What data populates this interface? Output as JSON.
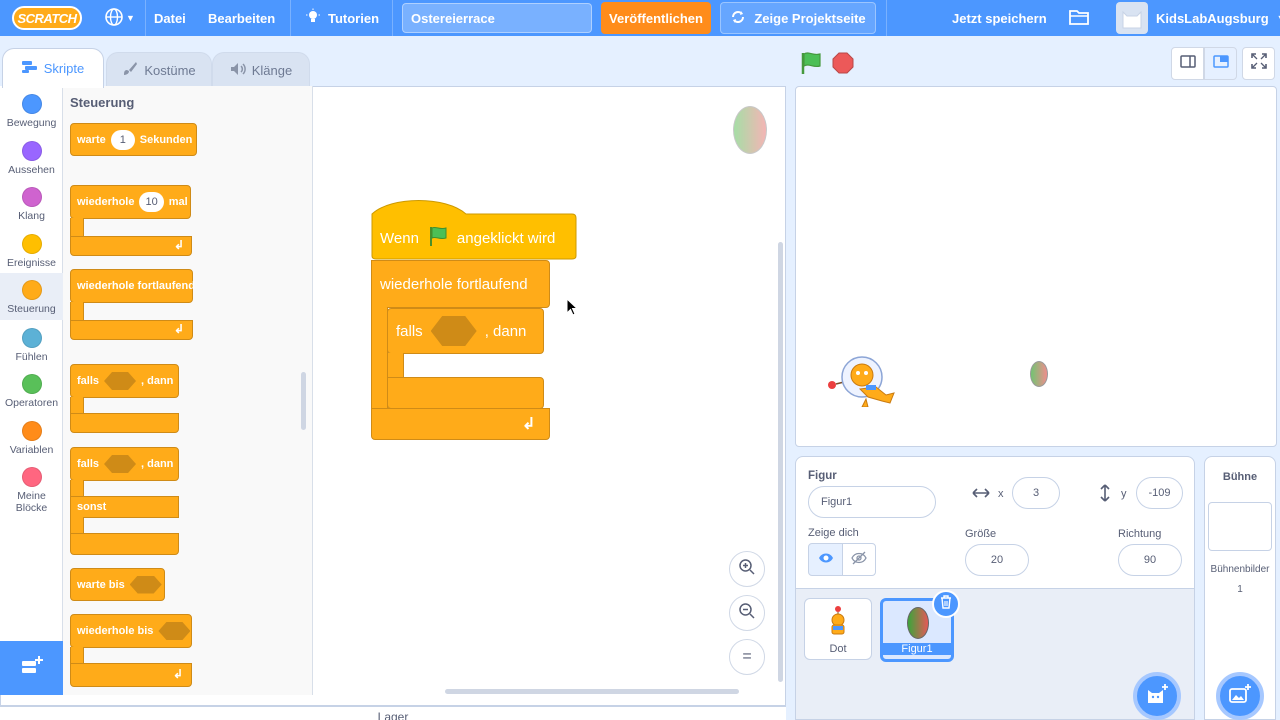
{
  "menubar": {
    "logo": "SCRATCH",
    "file": "Datei",
    "edit": "Bearbeiten",
    "tutorials": "Tutorien",
    "project_title": "Ostereierrace",
    "share": "Veröffentlichen",
    "see_project_page": "Zeige Projektseite",
    "save_now": "Jetzt speichern",
    "username": "KidsLabAugsburg"
  },
  "tabs": {
    "code": "Skripte",
    "costumes": "Kostüme",
    "sounds": "Klänge"
  },
  "categories": [
    {
      "label": "Bewegung",
      "color": "#4c97ff"
    },
    {
      "label": "Aussehen",
      "color": "#9966ff"
    },
    {
      "label": "Klang",
      "color": "#cf63cf"
    },
    {
      "label": "Ereignisse",
      "color": "#ffbf00"
    },
    {
      "label": "Steuerung",
      "color": "#ffab19"
    },
    {
      "label": "Fühlen",
      "color": "#5cb1d6"
    },
    {
      "label": "Operatoren",
      "color": "#59c059"
    },
    {
      "label": "Variablen",
      "color": "#ff8c1a"
    },
    {
      "label": "Meine Blöcke",
      "color": "#ff6680"
    }
  ],
  "palette": {
    "heading": "Steuerung",
    "wait_pre": "warte",
    "wait_num": "1",
    "wait_post": "Sekunden",
    "repeat_pre": "wiederhole",
    "repeat_num": "10",
    "repeat_post": "mal",
    "forever": "wiederhole fortlaufend",
    "if_pre": "falls",
    "if_post": ", dann",
    "ifelse_pre": "falls",
    "ifelse_post": ", dann",
    "else": "sonst",
    "wait_until": "warte bis",
    "repeat_until": "wiederhole bis"
  },
  "script": {
    "when_flag_pre": "Wenn",
    "when_flag_post": "angeklickt wird",
    "forever": "wiederhole fortlaufend",
    "if_pre": "falls",
    "if_post": ", dann"
  },
  "lager": "Lager",
  "sprite_info": {
    "sprite_label": "Figur",
    "sprite_name": "Figur1",
    "x_label": "x",
    "x": "3",
    "y_label": "y",
    "y": "-109",
    "show_label": "Zeige dich",
    "size_label": "Größe",
    "size": "20",
    "direction_label": "Richtung",
    "direction": "90"
  },
  "sprites": [
    {
      "name": "Dot",
      "selected": false
    },
    {
      "name": "Figur1",
      "selected": true
    }
  ],
  "stage_panel": {
    "title": "Bühne",
    "backdrops_label": "Bühnenbilder",
    "backdrops_count": "1"
  }
}
